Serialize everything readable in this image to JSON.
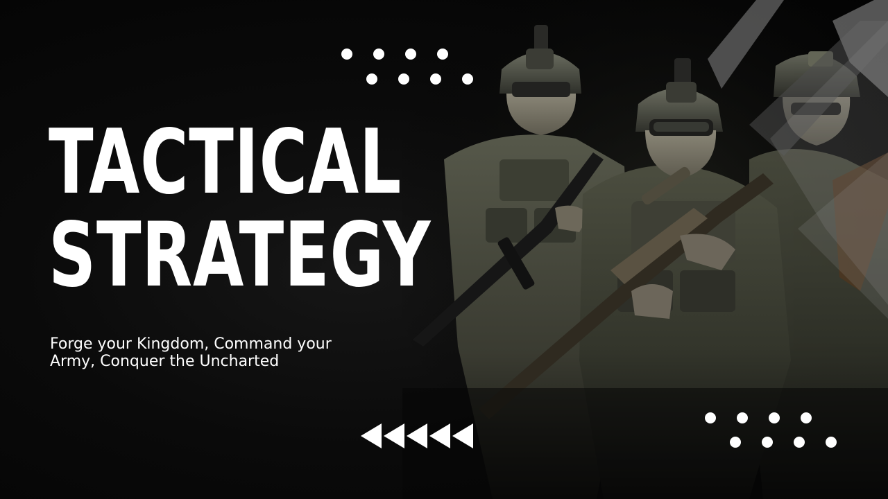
{
  "slide": {
    "title_line1": "TACTICAL",
    "title_line2": "STRATEGY",
    "subtitle": "Forge your Kingdom, Command your Army, Conquer the Uncharted"
  },
  "decor": {
    "image": "three-soldiers-photo",
    "icons": [
      "dot-grid-icon",
      "dot-grid-icon",
      "left-triangles-icon",
      "chevron-shape-icon"
    ],
    "colors": {
      "background": "#050505",
      "text": "#ffffff",
      "accent_gray": "#5a5a5a"
    }
  }
}
